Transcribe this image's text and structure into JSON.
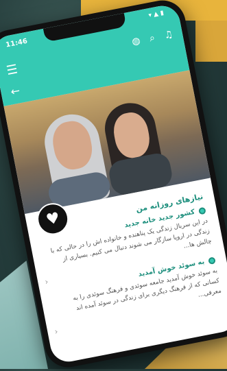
{
  "status": {
    "time": "11:46"
  },
  "header": {
    "menu_icon": "hamburger-icon",
    "back_icon": "arrow-left-icon",
    "actions": [
      "globe-icon",
      "search-icon",
      "bell-icon"
    ]
  },
  "colors": {
    "accent": "#35c9b3",
    "accent_dark": "#1d8f7d"
  },
  "section": {
    "title": "نیازهای روزانه من"
  },
  "items": [
    {
      "title": "کشور جدید خانه جدید",
      "body": "در این سریال زندگی یک پناهنده و خانواده اش را در حالی که با زندگی در اروپا سازگار می شوند دنبال می کنیم. بسیاری از چالش ها..."
    },
    {
      "title": "به سوئد خوش آمدید",
      "body": "به سوئد خوش آمدید جامعه سوئدی و فرهنگ سوئدی را به کسانی که از فرهنگ دیگری برای زندگی در سوئد آمده اند معرفی..."
    }
  ]
}
